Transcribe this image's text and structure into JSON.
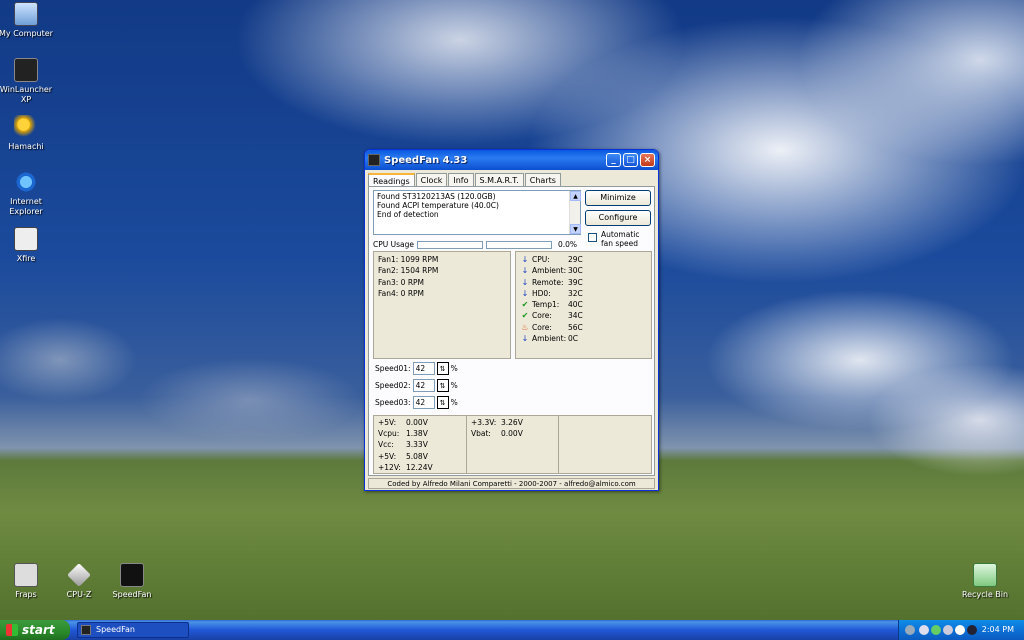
{
  "desktop": {
    "icons": [
      {
        "label": "My Computer"
      },
      {
        "label": "WinLauncher XP"
      },
      {
        "label": "Hamachi"
      },
      {
        "label": "Internet Explorer"
      },
      {
        "label": "Xfire"
      },
      {
        "label": "Fraps"
      },
      {
        "label": "CPU-Z"
      },
      {
        "label": "SpeedFan"
      },
      {
        "label": "Recycle Bin"
      }
    ]
  },
  "window": {
    "title": "SpeedFan 4.33",
    "tabs": [
      "Readings",
      "Clock",
      "Info",
      "S.M.A.R.T.",
      "Charts"
    ],
    "log_lines": [
      "Found ST3120213AS (120.0GB)",
      "Found ACPI temperature (40.0C)",
      "End of detection"
    ],
    "buttons": {
      "minimize": "Minimize",
      "configure": "Configure"
    },
    "auto_fan_label": "Automatic fan speed",
    "cpu_usage_label": "CPU Usage",
    "cpu_usage_value": "0.0%",
    "fans": [
      "Fan1: 1099 RPM",
      "Fan2: 1504 RPM",
      "Fan3: 0 RPM",
      "Fan4: 0 RPM"
    ],
    "temps": [
      {
        "name": "CPU:",
        "value": "29C",
        "status": "down"
      },
      {
        "name": "Ambient:",
        "value": "30C",
        "status": "down"
      },
      {
        "name": "Remote:",
        "value": "39C",
        "status": "down"
      },
      {
        "name": "HD0:",
        "value": "32C",
        "status": "down"
      },
      {
        "name": "Temp1:",
        "value": "40C",
        "status": "ok"
      },
      {
        "name": "Core:",
        "value": "34C",
        "status": "ok"
      },
      {
        "name": "Core:",
        "value": "56C",
        "status": "hot"
      },
      {
        "name": "Ambient:",
        "value": "0C",
        "status": "down"
      }
    ],
    "speeds": [
      {
        "label": "Speed01:",
        "value": "42",
        "unit": "%"
      },
      {
        "label": "Speed02:",
        "value": "42",
        "unit": "%"
      },
      {
        "label": "Speed03:",
        "value": "42",
        "unit": "%"
      }
    ],
    "volts_left": [
      {
        "name": "+5V:",
        "value": "0.00V"
      },
      {
        "name": "Vcpu:",
        "value": "1.38V"
      },
      {
        "name": "Vcc:",
        "value": "3.33V"
      },
      {
        "name": "+5V:",
        "value": "5.08V"
      },
      {
        "name": "+12V:",
        "value": "12.24V"
      }
    ],
    "volts_right": [
      {
        "name": "+3.3V:",
        "value": "3.26V"
      },
      {
        "name": "Vbat:",
        "value": "0.00V"
      }
    ],
    "status": "Coded by Alfredo Milani Comparetti - 2000-2007 - alfredo@almico.com"
  },
  "taskbar": {
    "start_label": "start",
    "task_label": "SpeedFan",
    "clock": "2:04 PM"
  },
  "colors": {
    "down_arrow": "#1a3fbf",
    "ok_check": "#1c9a1c",
    "hot_flame": "#e0501a"
  }
}
